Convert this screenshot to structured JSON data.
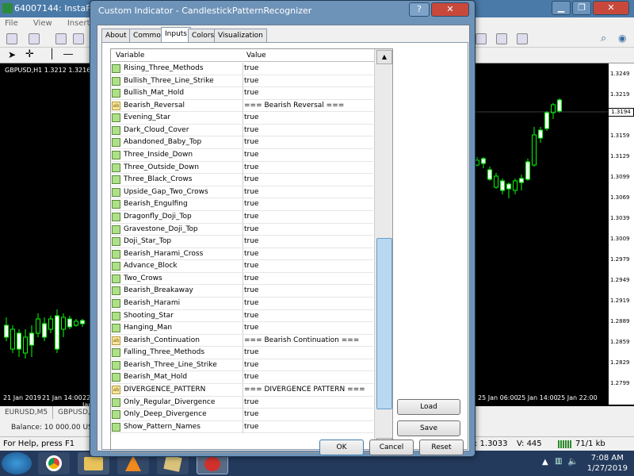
{
  "main_window": {
    "title": "64007144: InstaForex-1",
    "menu": [
      "File",
      "View",
      "Insert"
    ],
    "chart_label": "GBPUSD,H1  1.3212 1.3216 1",
    "price_box": "1.3194",
    "y_ticks": [
      "1.3249",
      "1.3219",
      "1.3189",
      "1.3159",
      "1.3129",
      "1.3099",
      "1.3069",
      "1.3039",
      "1.3009",
      "1.2979",
      "1.2949",
      "1.2919",
      "1.2889",
      "1.2859",
      "1.2829",
      "1.2799"
    ],
    "x_ticks_left": [
      "21 Jan 2019",
      "21 Jan 14:00",
      "22 Jan 06:00"
    ],
    "x_ticks_right": [
      "25 Jan 06:00",
      "25 Jan 14:00",
      "25 Jan 22:00"
    ],
    "bottom_tabs": [
      "EURUSD,M5",
      "GBPUSD,"
    ],
    "balance": "Balance: 10 000.00 USI",
    "status_left": "For Help, press F1",
    "status_c": "C: 1.3033",
    "status_v": "V: 445",
    "status_kb": "71/1 kb"
  },
  "taskbar": {
    "time": "7:08 AM",
    "date": "1/27/2019"
  },
  "dialog": {
    "title": "Custom Indicator - CandlestickPatternRecognizer",
    "tabs": [
      "About",
      "Common",
      "Inputs",
      "Colors",
      "Visualization"
    ],
    "active_tab": "Inputs",
    "col_variable": "Variable",
    "col_value": "Value",
    "rows": [
      {
        "name": "Rising_Three_Methods",
        "value": "true",
        "type": "bool"
      },
      {
        "name": "Bullish_Three_Line_Strike",
        "value": "true",
        "type": "bool"
      },
      {
        "name": "Bullish_Mat_Hold",
        "value": "true",
        "type": "bool"
      },
      {
        "name": "Bearish_Reversal",
        "value": "=== Bearish Reversal ===",
        "type": "string"
      },
      {
        "name": "Evening_Star",
        "value": "true",
        "type": "bool"
      },
      {
        "name": "Dark_Cloud_Cover",
        "value": "true",
        "type": "bool"
      },
      {
        "name": "Abandoned_Baby_Top",
        "value": "true",
        "type": "bool"
      },
      {
        "name": "Three_Inside_Down",
        "value": "true",
        "type": "bool"
      },
      {
        "name": "Three_Outside_Down",
        "value": "true",
        "type": "bool"
      },
      {
        "name": "Three_Black_Crows",
        "value": "true",
        "type": "bool"
      },
      {
        "name": "Upside_Gap_Two_Crows",
        "value": "true",
        "type": "bool"
      },
      {
        "name": "Bearish_Engulfing",
        "value": "true",
        "type": "bool"
      },
      {
        "name": "Dragonfly_Doji_Top",
        "value": "true",
        "type": "bool"
      },
      {
        "name": "Gravestone_Doji_Top",
        "value": "true",
        "type": "bool"
      },
      {
        "name": "Doji_Star_Top",
        "value": "true",
        "type": "bool"
      },
      {
        "name": "Bearish_Harami_Cross",
        "value": "true",
        "type": "bool"
      },
      {
        "name": "Advance_Block",
        "value": "true",
        "type": "bool"
      },
      {
        "name": "Two_Crows",
        "value": "true",
        "type": "bool"
      },
      {
        "name": "Bearish_Breakaway",
        "value": "true",
        "type": "bool"
      },
      {
        "name": "Bearish_Harami",
        "value": "true",
        "type": "bool"
      },
      {
        "name": "Shooting_Star",
        "value": "true",
        "type": "bool"
      },
      {
        "name": "Hanging_Man",
        "value": "true",
        "type": "bool"
      },
      {
        "name": "Bearish_Continuation",
        "value": "=== Bearish Continuation ===",
        "type": "string"
      },
      {
        "name": "Falling_Three_Methods",
        "value": "true",
        "type": "bool"
      },
      {
        "name": "Bearish_Three_Line_Strike",
        "value": "true",
        "type": "bool"
      },
      {
        "name": "Bearish_Mat_Hold",
        "value": "true",
        "type": "bool"
      },
      {
        "name": "DIVERGENCE_PATTERN",
        "value": "=== DIVERGENCE PATTERN ===",
        "type": "string"
      },
      {
        "name": "Only_Regular_Divergence",
        "value": "true",
        "type": "bool"
      },
      {
        "name": "Only_Deep_Divergence",
        "value": "true",
        "type": "bool"
      },
      {
        "name": "Show_Pattern_Names",
        "value": "true",
        "type": "bool"
      }
    ],
    "load_label": "Load",
    "save_label": "Save",
    "ok_label": "OK",
    "cancel_label": "Cancel",
    "reset_label": "Reset"
  },
  "colors": {
    "candle_bull": "#00ff00",
    "candle_bear": "#ffffff",
    "chart_bg": "#000000",
    "bool_icon": "#aee08a",
    "string_icon": "#f6e7a3"
  }
}
